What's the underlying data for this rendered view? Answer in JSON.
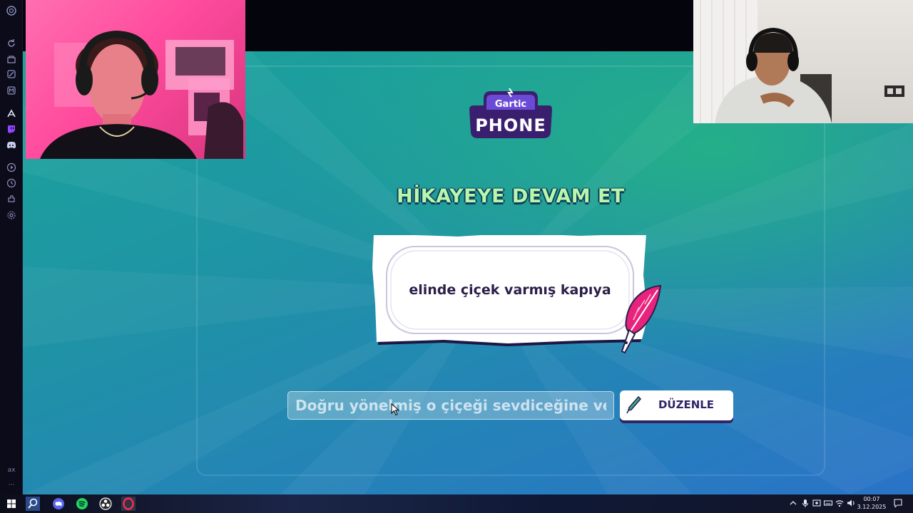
{
  "game": {
    "heading": "HİKAYEYE DEVAM ET",
    "logo_top": "Gartic",
    "logo_bottom": "PHONE",
    "prompt_text": "elinde çiçek varmış kapıya",
    "answer_value": "Doğru yönelmiş o çiçeği sevdiceğine verice",
    "edit_button_label": "DÜZENLE"
  },
  "sidebar": {
    "bottom_text": "ax",
    "more_text": "···"
  },
  "taskbar": {
    "time": "00:07",
    "date": "3.12.2025"
  },
  "colors": {
    "heading_fill": "#b7f7ad",
    "heading_outline": "#103d58",
    "logo_purple": "#3a1f6e",
    "quill_pink": "#e8237d",
    "button_text": "#2f2466"
  }
}
